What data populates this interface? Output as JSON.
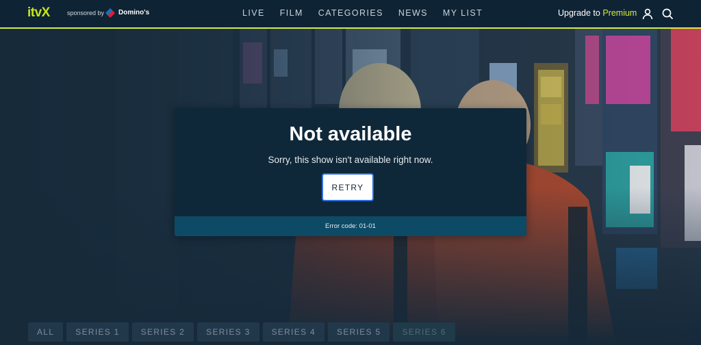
{
  "header": {
    "logo_text": "itvX",
    "sponsor_prefix": "sponsored by",
    "sponsor_name": "Domino's",
    "nav": [
      {
        "label": "LIVE"
      },
      {
        "label": "FILM"
      },
      {
        "label": "CATEGORIES"
      },
      {
        "label": "NEWS"
      },
      {
        "label": "MY LIST"
      }
    ],
    "upgrade_prefix": "Upgrade to",
    "upgrade_highlight": "Premium",
    "icons": [
      "account-icon",
      "search-icon"
    ],
    "accent_color": "#d6ec3f"
  },
  "modal": {
    "title": "Not available",
    "message": "Sorry, this show isn't available right now.",
    "retry_label": "RETRY",
    "error_code": "Error code: 01-01"
  },
  "series_tabs": [
    {
      "label": "ALL"
    },
    {
      "label": "SERIES 1"
    },
    {
      "label": "SERIES 2"
    },
    {
      "label": "SERIES 3"
    },
    {
      "label": "SERIES 4"
    },
    {
      "label": "SERIES 5"
    },
    {
      "label": "SERIES 6"
    }
  ]
}
